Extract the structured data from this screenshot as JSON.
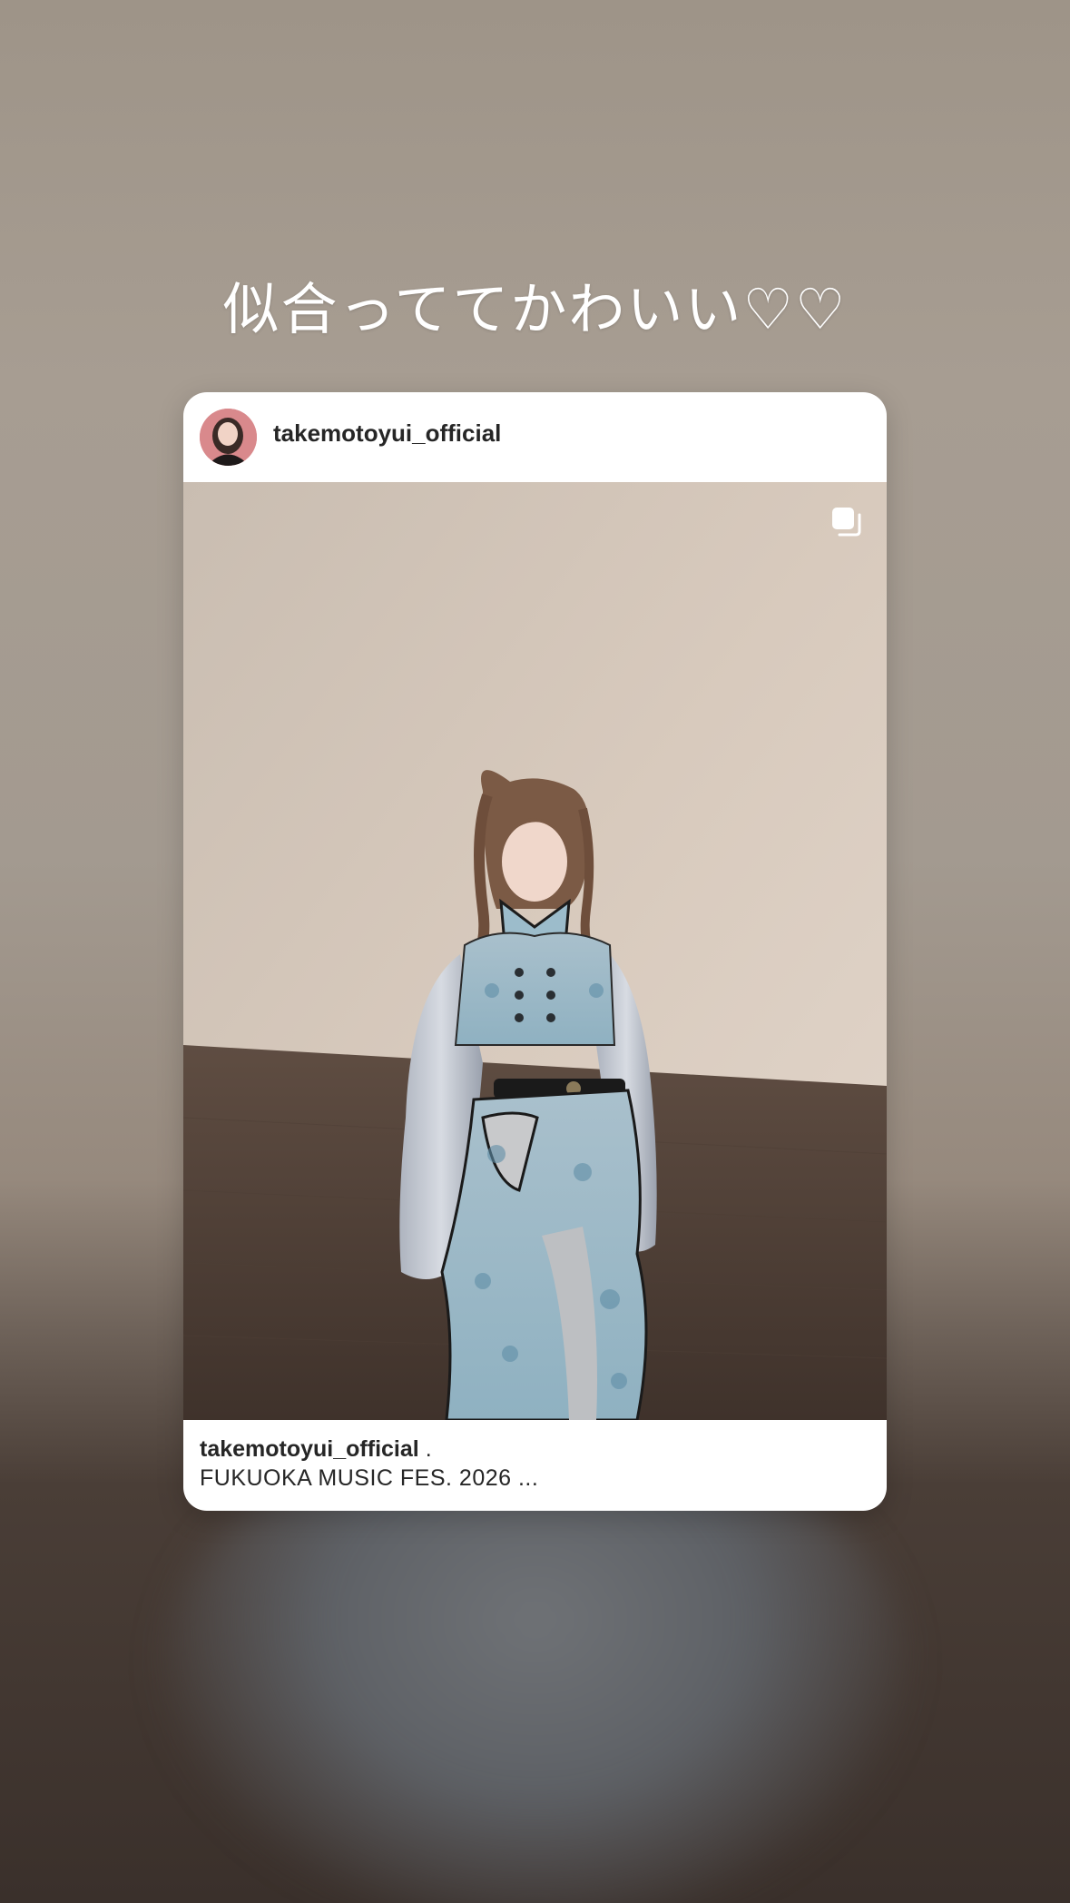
{
  "story": {
    "caption": "似合っててかわいい♡♡"
  },
  "post": {
    "username": "takemotoyui_official",
    "avatar_icon": "profile-avatar",
    "multi_photo_icon": "carousel-icon",
    "footer": {
      "username": "takemotoyui_official",
      "separator": ".",
      "caption": "FUKUOKA MUSIC FES. 2026 ..."
    }
  },
  "colors": {
    "card_background": "#ffffff",
    "text_primary": "#262626",
    "story_text": "#ffffff"
  }
}
